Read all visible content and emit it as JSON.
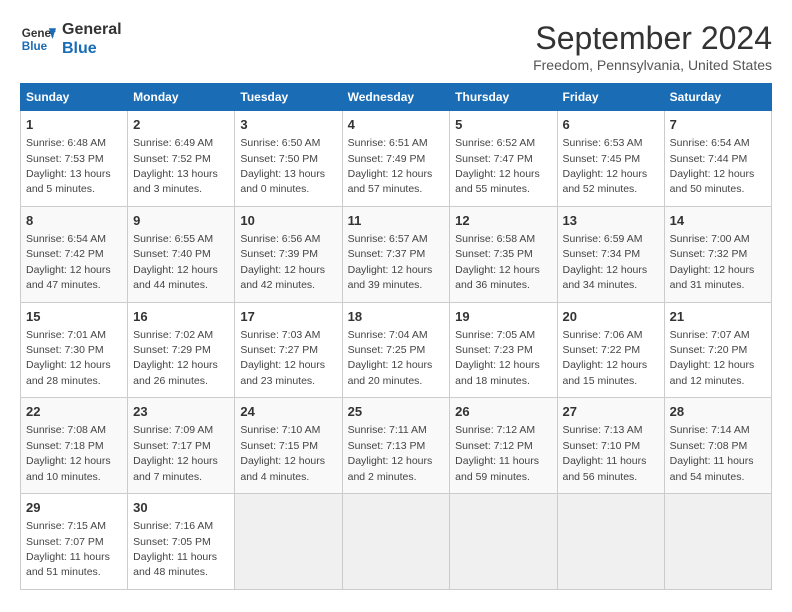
{
  "header": {
    "logo_line1": "General",
    "logo_line2": "Blue",
    "title": "September 2024",
    "subtitle": "Freedom, Pennsylvania, United States"
  },
  "calendar": {
    "days_of_week": [
      "Sunday",
      "Monday",
      "Tuesday",
      "Wednesday",
      "Thursday",
      "Friday",
      "Saturday"
    ],
    "weeks": [
      [
        {
          "day": "1",
          "sunrise": "Sunrise: 6:48 AM",
          "sunset": "Sunset: 7:53 PM",
          "daylight": "Daylight: 13 hours and 5 minutes."
        },
        {
          "day": "2",
          "sunrise": "Sunrise: 6:49 AM",
          "sunset": "Sunset: 7:52 PM",
          "daylight": "Daylight: 13 hours and 3 minutes."
        },
        {
          "day": "3",
          "sunrise": "Sunrise: 6:50 AM",
          "sunset": "Sunset: 7:50 PM",
          "daylight": "Daylight: 13 hours and 0 minutes."
        },
        {
          "day": "4",
          "sunrise": "Sunrise: 6:51 AM",
          "sunset": "Sunset: 7:49 PM",
          "daylight": "Daylight: 12 hours and 57 minutes."
        },
        {
          "day": "5",
          "sunrise": "Sunrise: 6:52 AM",
          "sunset": "Sunset: 7:47 PM",
          "daylight": "Daylight: 12 hours and 55 minutes."
        },
        {
          "day": "6",
          "sunrise": "Sunrise: 6:53 AM",
          "sunset": "Sunset: 7:45 PM",
          "daylight": "Daylight: 12 hours and 52 minutes."
        },
        {
          "day": "7",
          "sunrise": "Sunrise: 6:54 AM",
          "sunset": "Sunset: 7:44 PM",
          "daylight": "Daylight: 12 hours and 50 minutes."
        }
      ],
      [
        {
          "day": "8",
          "sunrise": "Sunrise: 6:54 AM",
          "sunset": "Sunset: 7:42 PM",
          "daylight": "Daylight: 12 hours and 47 minutes."
        },
        {
          "day": "9",
          "sunrise": "Sunrise: 6:55 AM",
          "sunset": "Sunset: 7:40 PM",
          "daylight": "Daylight: 12 hours and 44 minutes."
        },
        {
          "day": "10",
          "sunrise": "Sunrise: 6:56 AM",
          "sunset": "Sunset: 7:39 PM",
          "daylight": "Daylight: 12 hours and 42 minutes."
        },
        {
          "day": "11",
          "sunrise": "Sunrise: 6:57 AM",
          "sunset": "Sunset: 7:37 PM",
          "daylight": "Daylight: 12 hours and 39 minutes."
        },
        {
          "day": "12",
          "sunrise": "Sunrise: 6:58 AM",
          "sunset": "Sunset: 7:35 PM",
          "daylight": "Daylight: 12 hours and 36 minutes."
        },
        {
          "day": "13",
          "sunrise": "Sunrise: 6:59 AM",
          "sunset": "Sunset: 7:34 PM",
          "daylight": "Daylight: 12 hours and 34 minutes."
        },
        {
          "day": "14",
          "sunrise": "Sunrise: 7:00 AM",
          "sunset": "Sunset: 7:32 PM",
          "daylight": "Daylight: 12 hours and 31 minutes."
        }
      ],
      [
        {
          "day": "15",
          "sunrise": "Sunrise: 7:01 AM",
          "sunset": "Sunset: 7:30 PM",
          "daylight": "Daylight: 12 hours and 28 minutes."
        },
        {
          "day": "16",
          "sunrise": "Sunrise: 7:02 AM",
          "sunset": "Sunset: 7:29 PM",
          "daylight": "Daylight: 12 hours and 26 minutes."
        },
        {
          "day": "17",
          "sunrise": "Sunrise: 7:03 AM",
          "sunset": "Sunset: 7:27 PM",
          "daylight": "Daylight: 12 hours and 23 minutes."
        },
        {
          "day": "18",
          "sunrise": "Sunrise: 7:04 AM",
          "sunset": "Sunset: 7:25 PM",
          "daylight": "Daylight: 12 hours and 20 minutes."
        },
        {
          "day": "19",
          "sunrise": "Sunrise: 7:05 AM",
          "sunset": "Sunset: 7:23 PM",
          "daylight": "Daylight: 12 hours and 18 minutes."
        },
        {
          "day": "20",
          "sunrise": "Sunrise: 7:06 AM",
          "sunset": "Sunset: 7:22 PM",
          "daylight": "Daylight: 12 hours and 15 minutes."
        },
        {
          "day": "21",
          "sunrise": "Sunrise: 7:07 AM",
          "sunset": "Sunset: 7:20 PM",
          "daylight": "Daylight: 12 hours and 12 minutes."
        }
      ],
      [
        {
          "day": "22",
          "sunrise": "Sunrise: 7:08 AM",
          "sunset": "Sunset: 7:18 PM",
          "daylight": "Daylight: 12 hours and 10 minutes."
        },
        {
          "day": "23",
          "sunrise": "Sunrise: 7:09 AM",
          "sunset": "Sunset: 7:17 PM",
          "daylight": "Daylight: 12 hours and 7 minutes."
        },
        {
          "day": "24",
          "sunrise": "Sunrise: 7:10 AM",
          "sunset": "Sunset: 7:15 PM",
          "daylight": "Daylight: 12 hours and 4 minutes."
        },
        {
          "day": "25",
          "sunrise": "Sunrise: 7:11 AM",
          "sunset": "Sunset: 7:13 PM",
          "daylight": "Daylight: 12 hours and 2 minutes."
        },
        {
          "day": "26",
          "sunrise": "Sunrise: 7:12 AM",
          "sunset": "Sunset: 7:12 PM",
          "daylight": "Daylight: 11 hours and 59 minutes."
        },
        {
          "day": "27",
          "sunrise": "Sunrise: 7:13 AM",
          "sunset": "Sunset: 7:10 PM",
          "daylight": "Daylight: 11 hours and 56 minutes."
        },
        {
          "day": "28",
          "sunrise": "Sunrise: 7:14 AM",
          "sunset": "Sunset: 7:08 PM",
          "daylight": "Daylight: 11 hours and 54 minutes."
        }
      ],
      [
        {
          "day": "29",
          "sunrise": "Sunrise: 7:15 AM",
          "sunset": "Sunset: 7:07 PM",
          "daylight": "Daylight: 11 hours and 51 minutes."
        },
        {
          "day": "30",
          "sunrise": "Sunrise: 7:16 AM",
          "sunset": "Sunset: 7:05 PM",
          "daylight": "Daylight: 11 hours and 48 minutes."
        },
        null,
        null,
        null,
        null,
        null
      ]
    ]
  }
}
